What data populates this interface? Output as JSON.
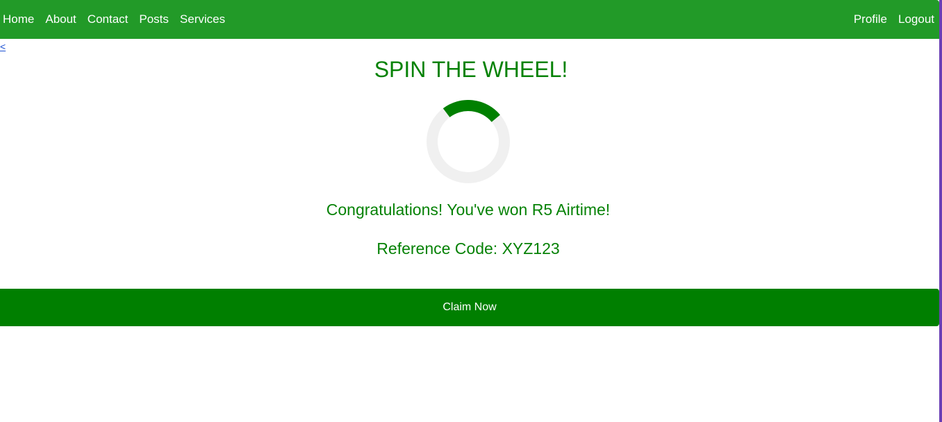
{
  "nav": {
    "left": [
      "Home",
      "About",
      "Contact",
      "Posts",
      "Services"
    ],
    "right": [
      "Profile",
      "Logout"
    ]
  },
  "back_link": "<",
  "title": "SPIN THE WHEEL!",
  "result_text": "Congratulations! You've won R5 Airtime!",
  "reference_text": "Reference Code: XYZ123",
  "claim_button_label": "Claim Now",
  "colors": {
    "navbar": "#229a28",
    "text_green": "#068206",
    "button": "#007f00",
    "spinner_track": "#f0f0f0",
    "spinner_arc": "#008000",
    "link": "#1a4fd1",
    "right_border": "#6a3fb5"
  }
}
